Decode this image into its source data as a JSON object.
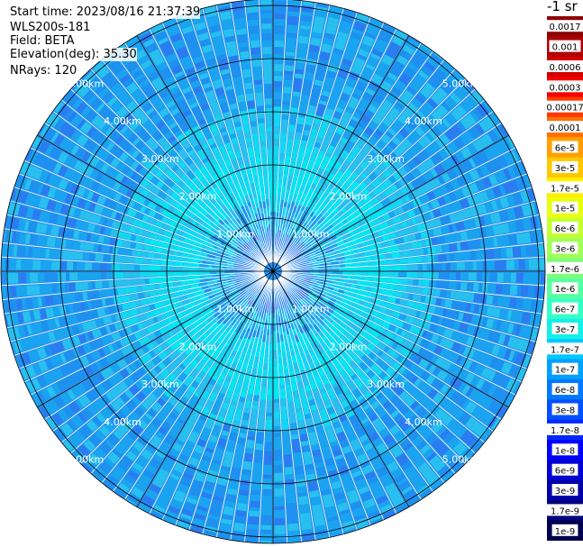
{
  "header": {
    "start_time": "Start time: 2023/08/16 21:37:39",
    "instrument": "WLS200s-181",
    "field": "Field: BETA",
    "elevation": "Elevation(deg): 35.30",
    "nrays": "NRays: 120"
  },
  "colorbar": {
    "unit": "-1 sr",
    "labels": [
      "0.0017",
      "0.001",
      "0.0006",
      "0.0003",
      "0.00017",
      "0.0001",
      "6e-5",
      "3e-5",
      "1.7e-5",
      "1e-5",
      "6e-6",
      "3e-6",
      "1.7e-6",
      "1e-6",
      "6e-7",
      "3e-7",
      "1.7e-7",
      "1e-7",
      "6e-8",
      "3e-8",
      "1.7e-8",
      "1e-8",
      "6e-9",
      "3e-9",
      "1.7e-9",
      "1e-9"
    ],
    "colors": [
      "#8b0000",
      "#b00000",
      "#d40000",
      "#f40000",
      "#ff3a00",
      "#ff7000",
      "#ffa000",
      "#ffc800",
      "#ffee00",
      "#e8ff10",
      "#c4ff34",
      "#a0ff58",
      "#7cff7c",
      "#58ffa0",
      "#34ffc4",
      "#14f0e8",
      "#00c8ff",
      "#00a0ff",
      "#0078ff",
      "#0050ff",
      "#0028ff",
      "#0000ff",
      "#0000d4",
      "#0000a8",
      "#00007c",
      "#000050"
    ]
  },
  "rings": {
    "labels": [
      "1.00km",
      "2.00km",
      "3.00km",
      "4.00km",
      "5.00km"
    ]
  }
}
